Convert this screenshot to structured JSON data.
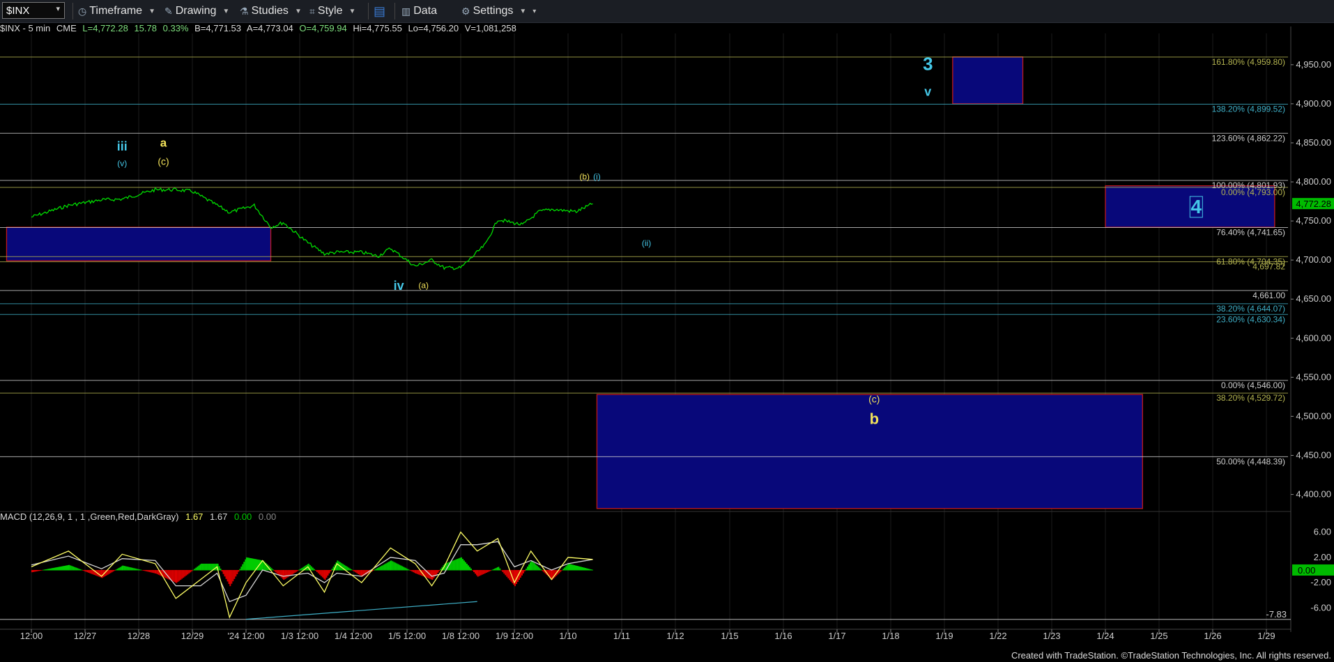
{
  "toolbar": {
    "symbol": "$INX",
    "timeframe": "Timeframe",
    "drawing": "Drawing",
    "studies": "Studies",
    "style": "Style",
    "data": "Data",
    "settings": "Settings"
  },
  "header": {
    "symbol": "$INX - 5 min",
    "exchange": "CME",
    "last": "L=4,772.28",
    "change": "15.78",
    "change_pct": "0.33%",
    "bid": "B=4,771.53",
    "ask": "A=4,773.04",
    "open": "O=4,759.94",
    "high": "Hi=4,775.55",
    "low": "Lo=4,756.20",
    "volume": "V=1,081,258"
  },
  "macd_header": {
    "label": "MACD (12,26,9, 1 , 1 ,Green,Red,DarkGray)",
    "macd": "1.67",
    "avg": "1.67",
    "diff": "0.00",
    "zero": "0.00"
  },
  "footer": "Created with TradeStation. ©TradeStation Technologies, Inc. All rights reserved.",
  "colors": {
    "background": "#000000",
    "price": "#00dd00",
    "zone_fill": "#08087a",
    "zone_border": "#c21a1a",
    "fib_yellow": "#b5b550",
    "fib_cyan": "#3fb0c8",
    "label_yellow": "#f2e25a",
    "label_cyan": "#45c8e8",
    "macd_line": "#ffff66",
    "avg_line": "#d8d8d8",
    "hist_up": "#00cc00",
    "hist_down": "#dd0000",
    "last_price_badge": "#00bb00"
  },
  "chart_data": [
    {
      "type": "line",
      "title": "$INX - 5 min",
      "x_ticks": [
        "12:00",
        "12/27",
        "12/28",
        "12/29",
        "'24 12:00",
        "1/3 12:00",
        "1/4 12:00",
        "1/5 12:00",
        "1/8 12:00",
        "1/9 12:00",
        "1/10",
        "1/11",
        "1/12",
        "1/15",
        "1/16",
        "1/17",
        "1/18",
        "1/19",
        "1/22",
        "1/23",
        "1/24",
        "1/25",
        "1/26",
        "1/29"
      ],
      "ylim": [
        4380,
        4990
      ],
      "y_ticks": [
        "4,400.00",
        "4,450.00",
        "4,500.00",
        "4,550.00",
        "4,600.00",
        "4,650.00",
        "4,700.00",
        "4,750.00",
        "4,800.00",
        "4,850.00",
        "4,900.00",
        "4,950.00"
      ],
      "last_price": "4,772.28",
      "series": [
        {
          "x": [
            "12/26 12:00",
            "12/26 15:00",
            "12/27 10:00",
            "12/27 14:00",
            "12/28 10:00",
            "12/28 14:00",
            "12/29 10:00",
            "12/29 12:00",
            "12/29 15:00",
            "1/2 10:00",
            "1/2 13:00",
            "1/2 15:00",
            "1/3 10:00",
            "1/3 13:00",
            "1/3 15:00",
            "1/4 10:00",
            "1/4 13:00",
            "1/4 15:00",
            "1/5 10:00",
            "1/5 13:00",
            "1/5 15:00",
            "1/8 10:00",
            "1/8 12:00",
            "1/8 15:00",
            "1/9 10:00",
            "1/9 13:00",
            "1/9 15:00",
            "1/10 10:00",
            "1/10 13:00",
            "1/10 15:00"
          ],
          "values": [
            4755,
            4765,
            4770,
            4777,
            4778,
            4790,
            4790,
            4788,
            4770,
            4761,
            4770,
            4742,
            4748,
            4722,
            4708,
            4710,
            4710,
            4705,
            4715,
            4692,
            4700,
            4690,
            4690,
            4720,
            4752,
            4745,
            4762,
            4765,
            4762,
            4772
          ]
        }
      ],
      "horizontal_lines": [
        {
          "label": "161.80% (4,959.80)",
          "value": 4959.8,
          "color": "yellow"
        },
        {
          "label": "138.20% (4,899.52)",
          "value": 4899.52,
          "color": "cyan"
        },
        {
          "label": "123.60% (4,862.22)",
          "value": 4862.22,
          "color": "white"
        },
        {
          "label": "100.00% (4,801.93)",
          "value": 4801.93,
          "color": "white"
        },
        {
          "label": "0.00% (4,793.00)",
          "value": 4793.0,
          "color": "yellow"
        },
        {
          "label": "76.40% (4,741.65)",
          "value": 4741.65,
          "color": "white"
        },
        {
          "label": "61.80% (4,704.35)",
          "value": 4704.35,
          "color": "yellow"
        },
        {
          "label": "4,697.82",
          "value": 4697.82,
          "color": "yellow"
        },
        {
          "label": "4,661.00",
          "value": 4661.0,
          "color": "white"
        },
        {
          "label": "38.20% (4,644.07)",
          "value": 4644.07,
          "color": "cyan"
        },
        {
          "label": "23.60% (4,630.34)",
          "value": 4630.34,
          "color": "cyan"
        },
        {
          "label": "0.00% (4,546.00)",
          "value": 4546.0,
          "color": "white"
        },
        {
          "label": "38.20% (4,529.72)",
          "value": 4529.72,
          "color": "yellow"
        },
        {
          "label": "50.00% (4,448.39)",
          "value": 4448.39,
          "color": "white"
        }
      ],
      "zones": [
        {
          "x_from": "12/26 09:00",
          "x_to": "1/2 15:00",
          "y_from": 4699,
          "y_to": 4742
        },
        {
          "x_from": "1/19 13:00",
          "x_to": "1/22 15:00",
          "y_from": 4900,
          "y_to": 4960
        },
        {
          "x_from": "1/24 12:00",
          "x_to": "1/29 13:00",
          "y_from": 4742,
          "y_to": 4795
        },
        {
          "x_from": "1/11 09:00",
          "x_to": "1/25 10:00",
          "y_from": 4382,
          "y_to": 4528
        }
      ],
      "annotations": [
        {
          "text": "iii",
          "x": "12/28 10:00",
          "y": 4840,
          "color": "cyan"
        },
        {
          "text": "(v)",
          "x": "12/28 10:00",
          "y": 4820,
          "color": "cyan"
        },
        {
          "text": "a",
          "x": "12/28 15:00",
          "y": 4845,
          "color": "yellow"
        },
        {
          "text": "(c)",
          "x": "12/28 15:00",
          "y": 4822,
          "color": "yellow"
        },
        {
          "text": "(b)",
          "x": "1/10 14:00",
          "y": 4803,
          "color": "yellow"
        },
        {
          "text": "(i)",
          "x": "1/10 15:30",
          "y": 4803,
          "color": "cyan"
        },
        {
          "text": "(ii)",
          "x": "1/11 15:00",
          "y": 4718,
          "color": "cyan"
        },
        {
          "text": "iv",
          "x": "1/5 11:00",
          "y": 4662,
          "color": "cyan"
        },
        {
          "text": "(a)",
          "x": "1/5 14:00",
          "y": 4664,
          "color": "yellow"
        },
        {
          "text": "3",
          "x": "1/19 10:00",
          "y": 4943,
          "color": "cyan"
        },
        {
          "text": "v",
          "x": "1/19 10:00",
          "y": 4910,
          "color": "cyan"
        },
        {
          "text": "4",
          "x": "1/26 10:00",
          "y": 4760,
          "color": "cyan"
        },
        {
          "text": "(c)",
          "x": "1/18 10:00",
          "y": 4518,
          "color": "yellow"
        },
        {
          "text": "b",
          "x": "1/18 10:00",
          "y": 4490,
          "color": "yellow"
        }
      ]
    },
    {
      "type": "line",
      "title": "MACD (12,26,9, 1 , 1 ,Green,Red,DarkGray)",
      "ylim": [
        -8.5,
        7.5
      ],
      "y_ticks": [
        "6.00",
        "2.00",
        "0.00",
        "-2.00",
        "-6.00",
        "-7.83"
      ],
      "series": [
        {
          "name": "MACD",
          "x": [
            "12/26 12:00",
            "12/27 10:00",
            "12/27 14:00",
            "12/28 10:00",
            "12/28 14:00",
            "12/29 10:00",
            "12/29 13:00",
            "12/29 15:00",
            "1/2 10:00",
            "1/2 12:00",
            "1/2 14:00",
            "1/3 10:00",
            "1/3 13:00",
            "1/3 15:00",
            "1/4 10:00",
            "1/4 13:00",
            "1/5 10:00",
            "1/5 13:00",
            "1/5 15:00",
            "1/8 10:00",
            "1/8 12:00",
            "1/8 14:00",
            "1/9 10:00",
            "1/9 12:00",
            "1/9 14:00",
            "1/10 10:00",
            "1/10 12:00",
            "1/10 15:00"
          ],
          "values": [
            0.5,
            3.0,
            -1.0,
            2.5,
            1.0,
            -4.5,
            -1.5,
            0.5,
            -7.5,
            -2.0,
            1.5,
            -2.5,
            0.5,
            -3.5,
            1.0,
            -2.0,
            3.5,
            1.0,
            -2.5,
            0.5,
            6.0,
            3.0,
            5.0,
            -2.0,
            3.0,
            -1.5,
            2.0,
            1.67
          ]
        },
        {
          "name": "MACDAvg",
          "x": [
            "12/26 12:00",
            "12/27 10:00",
            "12/27 14:00",
            "12/28 10:00",
            "12/28 14:00",
            "12/29 10:00",
            "12/29 13:00",
            "12/29 15:00",
            "1/2 10:00",
            "1/2 12:00",
            "1/2 14:00",
            "1/3 10:00",
            "1/3 13:00",
            "1/3 15:00",
            "1/4 10:00",
            "1/4 13:00",
            "1/5 10:00",
            "1/5 13:00",
            "1/5 15:00",
            "1/8 10:00",
            "1/8 12:00",
            "1/8 14:00",
            "1/9 10:00",
            "1/9 12:00",
            "1/9 14:00",
            "1/10 10:00",
            "1/10 12:00",
            "1/10 15:00"
          ],
          "values": [
            0.8,
            2.2,
            0.2,
            1.8,
            1.5,
            -2.5,
            -2.5,
            -0.5,
            -5.0,
            -4.0,
            0.0,
            -1.0,
            -0.5,
            -2.0,
            -0.5,
            -1.0,
            2.0,
            1.5,
            -1.0,
            -0.5,
            4.0,
            4.0,
            4.5,
            0.5,
            1.5,
            0.0,
            1.0,
            1.67
          ]
        }
      ],
      "trendline": {
        "x_from": "1/2 12:00",
        "y_from": -7.8,
        "x_to": "1/8 14:00",
        "y_to": -5.0,
        "color": "cyan"
      }
    }
  ]
}
